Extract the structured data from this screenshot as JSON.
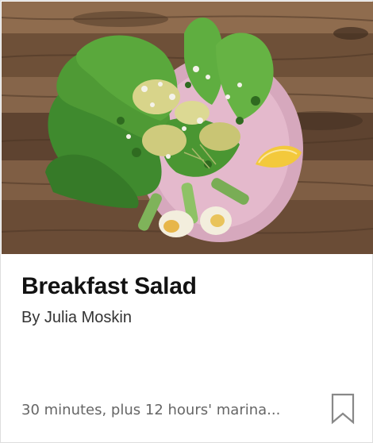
{
  "card": {
    "title": "Breakfast Salad",
    "byline": "By Julia Moskin",
    "time": "30 minutes, plus 12 hours' marina..."
  },
  "photo": {
    "alt": "Lettuce, avocado, cucumbers, eggs and lemon on a pink plate on a wooden table"
  },
  "icons": {
    "save": "bookmark-icon"
  },
  "colors": {
    "title": "#121212",
    "byline": "#333333",
    "meta": "#666666",
    "icon": "#888888",
    "border": "#dedede"
  }
}
